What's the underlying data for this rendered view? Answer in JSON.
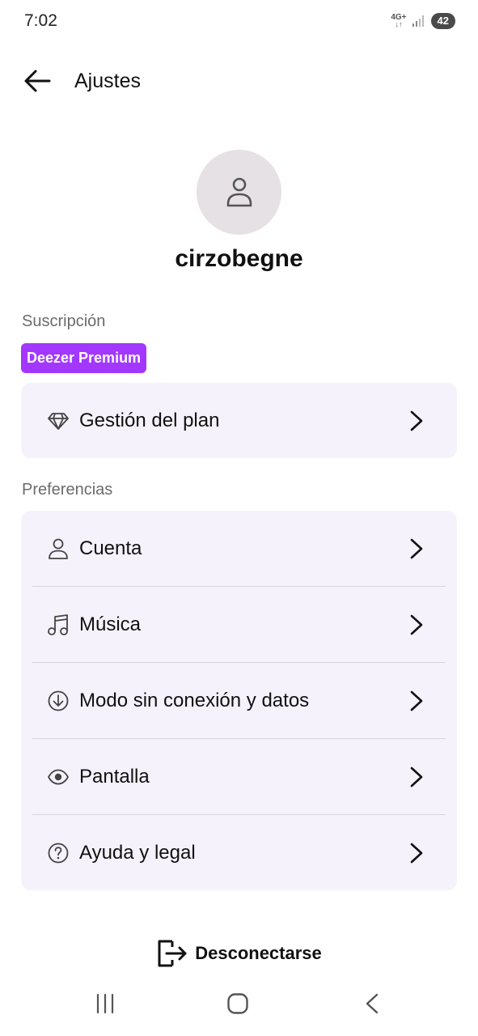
{
  "status_bar": {
    "time": "7:02",
    "network_type": "4G+",
    "battery": "42"
  },
  "app_bar": {
    "back_icon": "arrow-back-icon",
    "title": "Ajustes"
  },
  "profile": {
    "avatar_icon": "person-icon",
    "username": "cirzobegne"
  },
  "subscription": {
    "section_label": "Suscripción",
    "badge": "Deezer Premium",
    "items": [
      {
        "icon": "diamond-icon",
        "label": "Gestión del plan"
      }
    ]
  },
  "preferences": {
    "section_label": "Preferencias",
    "items": [
      {
        "icon": "person-icon",
        "label": "Cuenta"
      },
      {
        "icon": "music-note-icon",
        "label": "Música"
      },
      {
        "icon": "download-circle-icon",
        "label": "Modo sin conexión y datos"
      },
      {
        "icon": "eye-icon",
        "label": "Pantalla"
      },
      {
        "icon": "help-circle-icon",
        "label": "Ayuda y legal"
      }
    ]
  },
  "logout": {
    "icon": "logout-icon",
    "label": "Desconectarse"
  },
  "nav_bar": {
    "items": [
      "recents-icon",
      "home-icon",
      "back-icon"
    ]
  },
  "colors": {
    "accent": "#a238ff",
    "card_background": "#f5f2fc",
    "avatar_background": "#e6e1e5"
  }
}
